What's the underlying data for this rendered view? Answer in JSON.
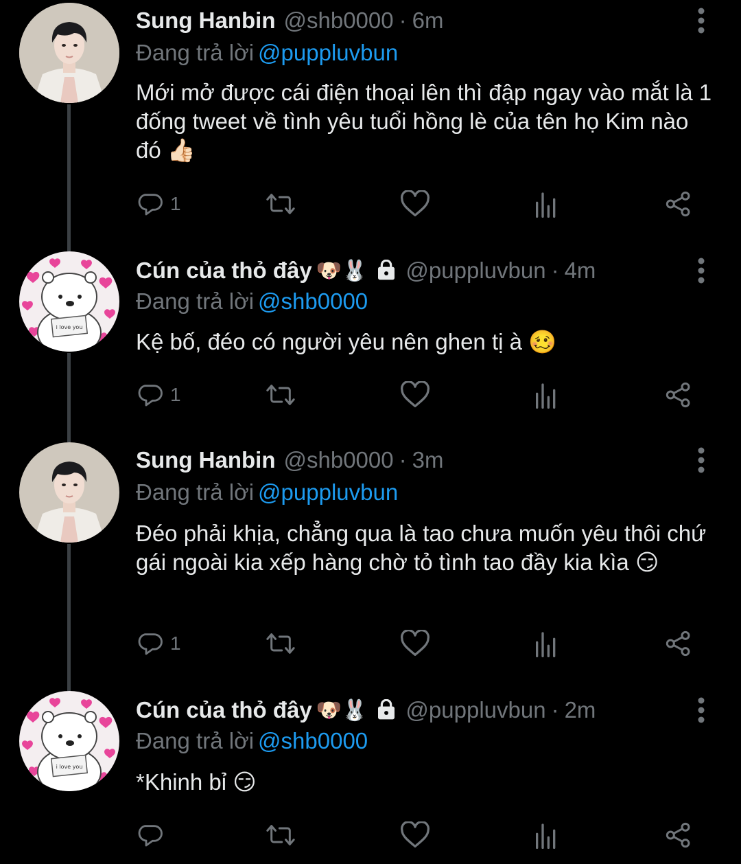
{
  "reply_prefix": "Đang trả lời",
  "tweets": [
    {
      "name": "Sung Hanbin",
      "badge": "",
      "handle": "@shb0000",
      "time": "6m",
      "reply_to": "@puppluvbun",
      "text": "Mới mở được cái điện thoại lên thì đập ngay vào mắt là 1 đống tweet về tình yêu tuổi hồng lè của tên họ Kim nào đó",
      "emoji": "👍🏻",
      "reply_count": "1"
    },
    {
      "name": "Cún của thỏ đây",
      "badge": "🐶🐰",
      "handle": "@puppluvbun",
      "time": "4m",
      "reply_to": "@shb0000",
      "text": "Kệ bố, đéo có người yêu nên ghen tị à",
      "emoji": "🥴",
      "reply_count": "1"
    },
    {
      "name": "Sung Hanbin",
      "badge": "",
      "handle": "@shb0000",
      "time": "3m",
      "reply_to": "@puppluvbun",
      "text": "Đéo phải khịa, chẳng qua là tao chưa muốn yêu thôi chứ gái ngoài kia xếp hàng chờ tỏ tình tao đầy kia kìa",
      "emoji": "😏",
      "reply_count": "1"
    },
    {
      "name": "Cún của thỏ đây",
      "badge": "🐶🐰",
      "handle": "@puppluvbun",
      "time": "2m",
      "reply_to": "@shb0000",
      "text": "*Khinh bỉ",
      "emoji": "😏",
      "reply_count": ""
    }
  ],
  "avatars": {
    "bear_sign_text": "i love you"
  },
  "icons": {
    "reply": "reply-icon",
    "retweet": "retweet-icon",
    "like": "heart-icon",
    "views": "views-icon",
    "share": "share-icon",
    "more": "more-vertical-icon",
    "lock": "lock-icon"
  },
  "colors": {
    "background": "#000000",
    "text": "#e7e9ea",
    "secondary": "#71767b",
    "link": "#1d9bf0"
  }
}
